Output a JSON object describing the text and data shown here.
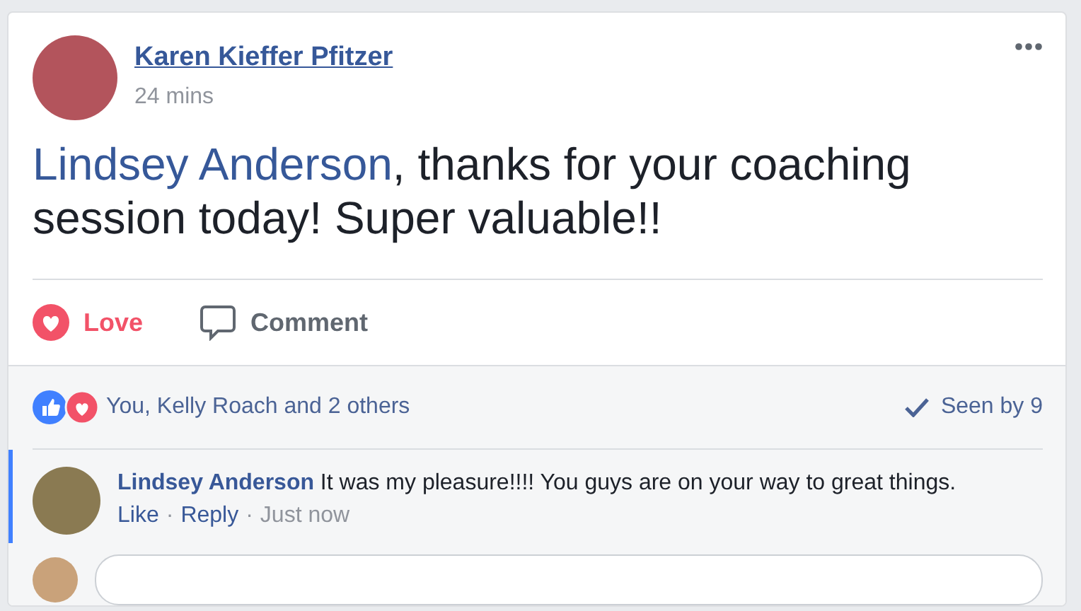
{
  "post": {
    "author": "Karen Kieffer Pfitzer",
    "time": "24 mins",
    "mention": "Lindsey Anderson",
    "text": ", thanks for your coaching session today! Super valuable!!"
  },
  "actions": [
    {
      "kind": "love",
      "label": "Love",
      "selected": true
    },
    {
      "kind": "comment",
      "label": "Comment",
      "selected": false
    }
  ],
  "reactions": {
    "summary": "You, Kelly Roach and 2 others",
    "seen": "Seen by 9"
  },
  "comments": [
    {
      "author": "Lindsey Anderson",
      "text": "It was my pleasure!!!! You guys are on your way to great things.",
      "highlighted": true,
      "links": [
        "Like",
        "Reply"
      ],
      "separator": "·",
      "time": "Just now"
    }
  ]
}
